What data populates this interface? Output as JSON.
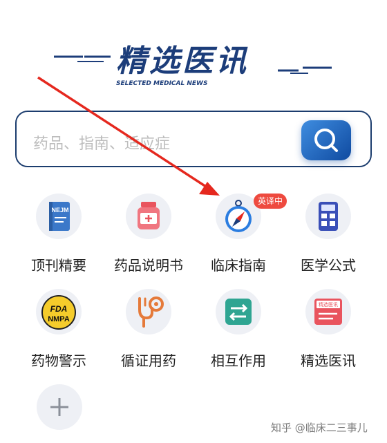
{
  "header": {
    "title": "精选医讯",
    "subtitle": "SELECTED MEDICAL NEWS"
  },
  "search": {
    "placeholder": "药品、指南、适应症",
    "button_icon": "search-icon"
  },
  "grid": {
    "items": [
      {
        "label": "顶刊精要",
        "icon": "nejm-book-icon",
        "icon_text": "NEJM"
      },
      {
        "label": "药品说明书",
        "icon": "medicine-bottle-icon"
      },
      {
        "label": "临床指南",
        "icon": "compass-icon",
        "badge": "英译中"
      },
      {
        "label": "医学公式",
        "icon": "calculator-icon"
      },
      {
        "label": "药物警示",
        "icon": "fda-nmpa-icon",
        "icon_text_1": "FDA",
        "icon_text_2": "NMPA"
      },
      {
        "label": "循证用药",
        "icon": "stethoscope-icon"
      },
      {
        "label": "相互作用",
        "icon": "exchange-icon"
      },
      {
        "label": "精选医讯",
        "icon": "news-card-icon",
        "icon_text": "精选医讯"
      }
    ],
    "add_icon": "plus-icon"
  },
  "watermark": "知乎 @临床二三事儿",
  "colors": {
    "brand_navy": "#1c3d7a",
    "search_button": "#1f63c4",
    "badge_red": "#ee4a3f",
    "arrow_red": "#e5281e",
    "icon_bg": "#eef0f5"
  }
}
